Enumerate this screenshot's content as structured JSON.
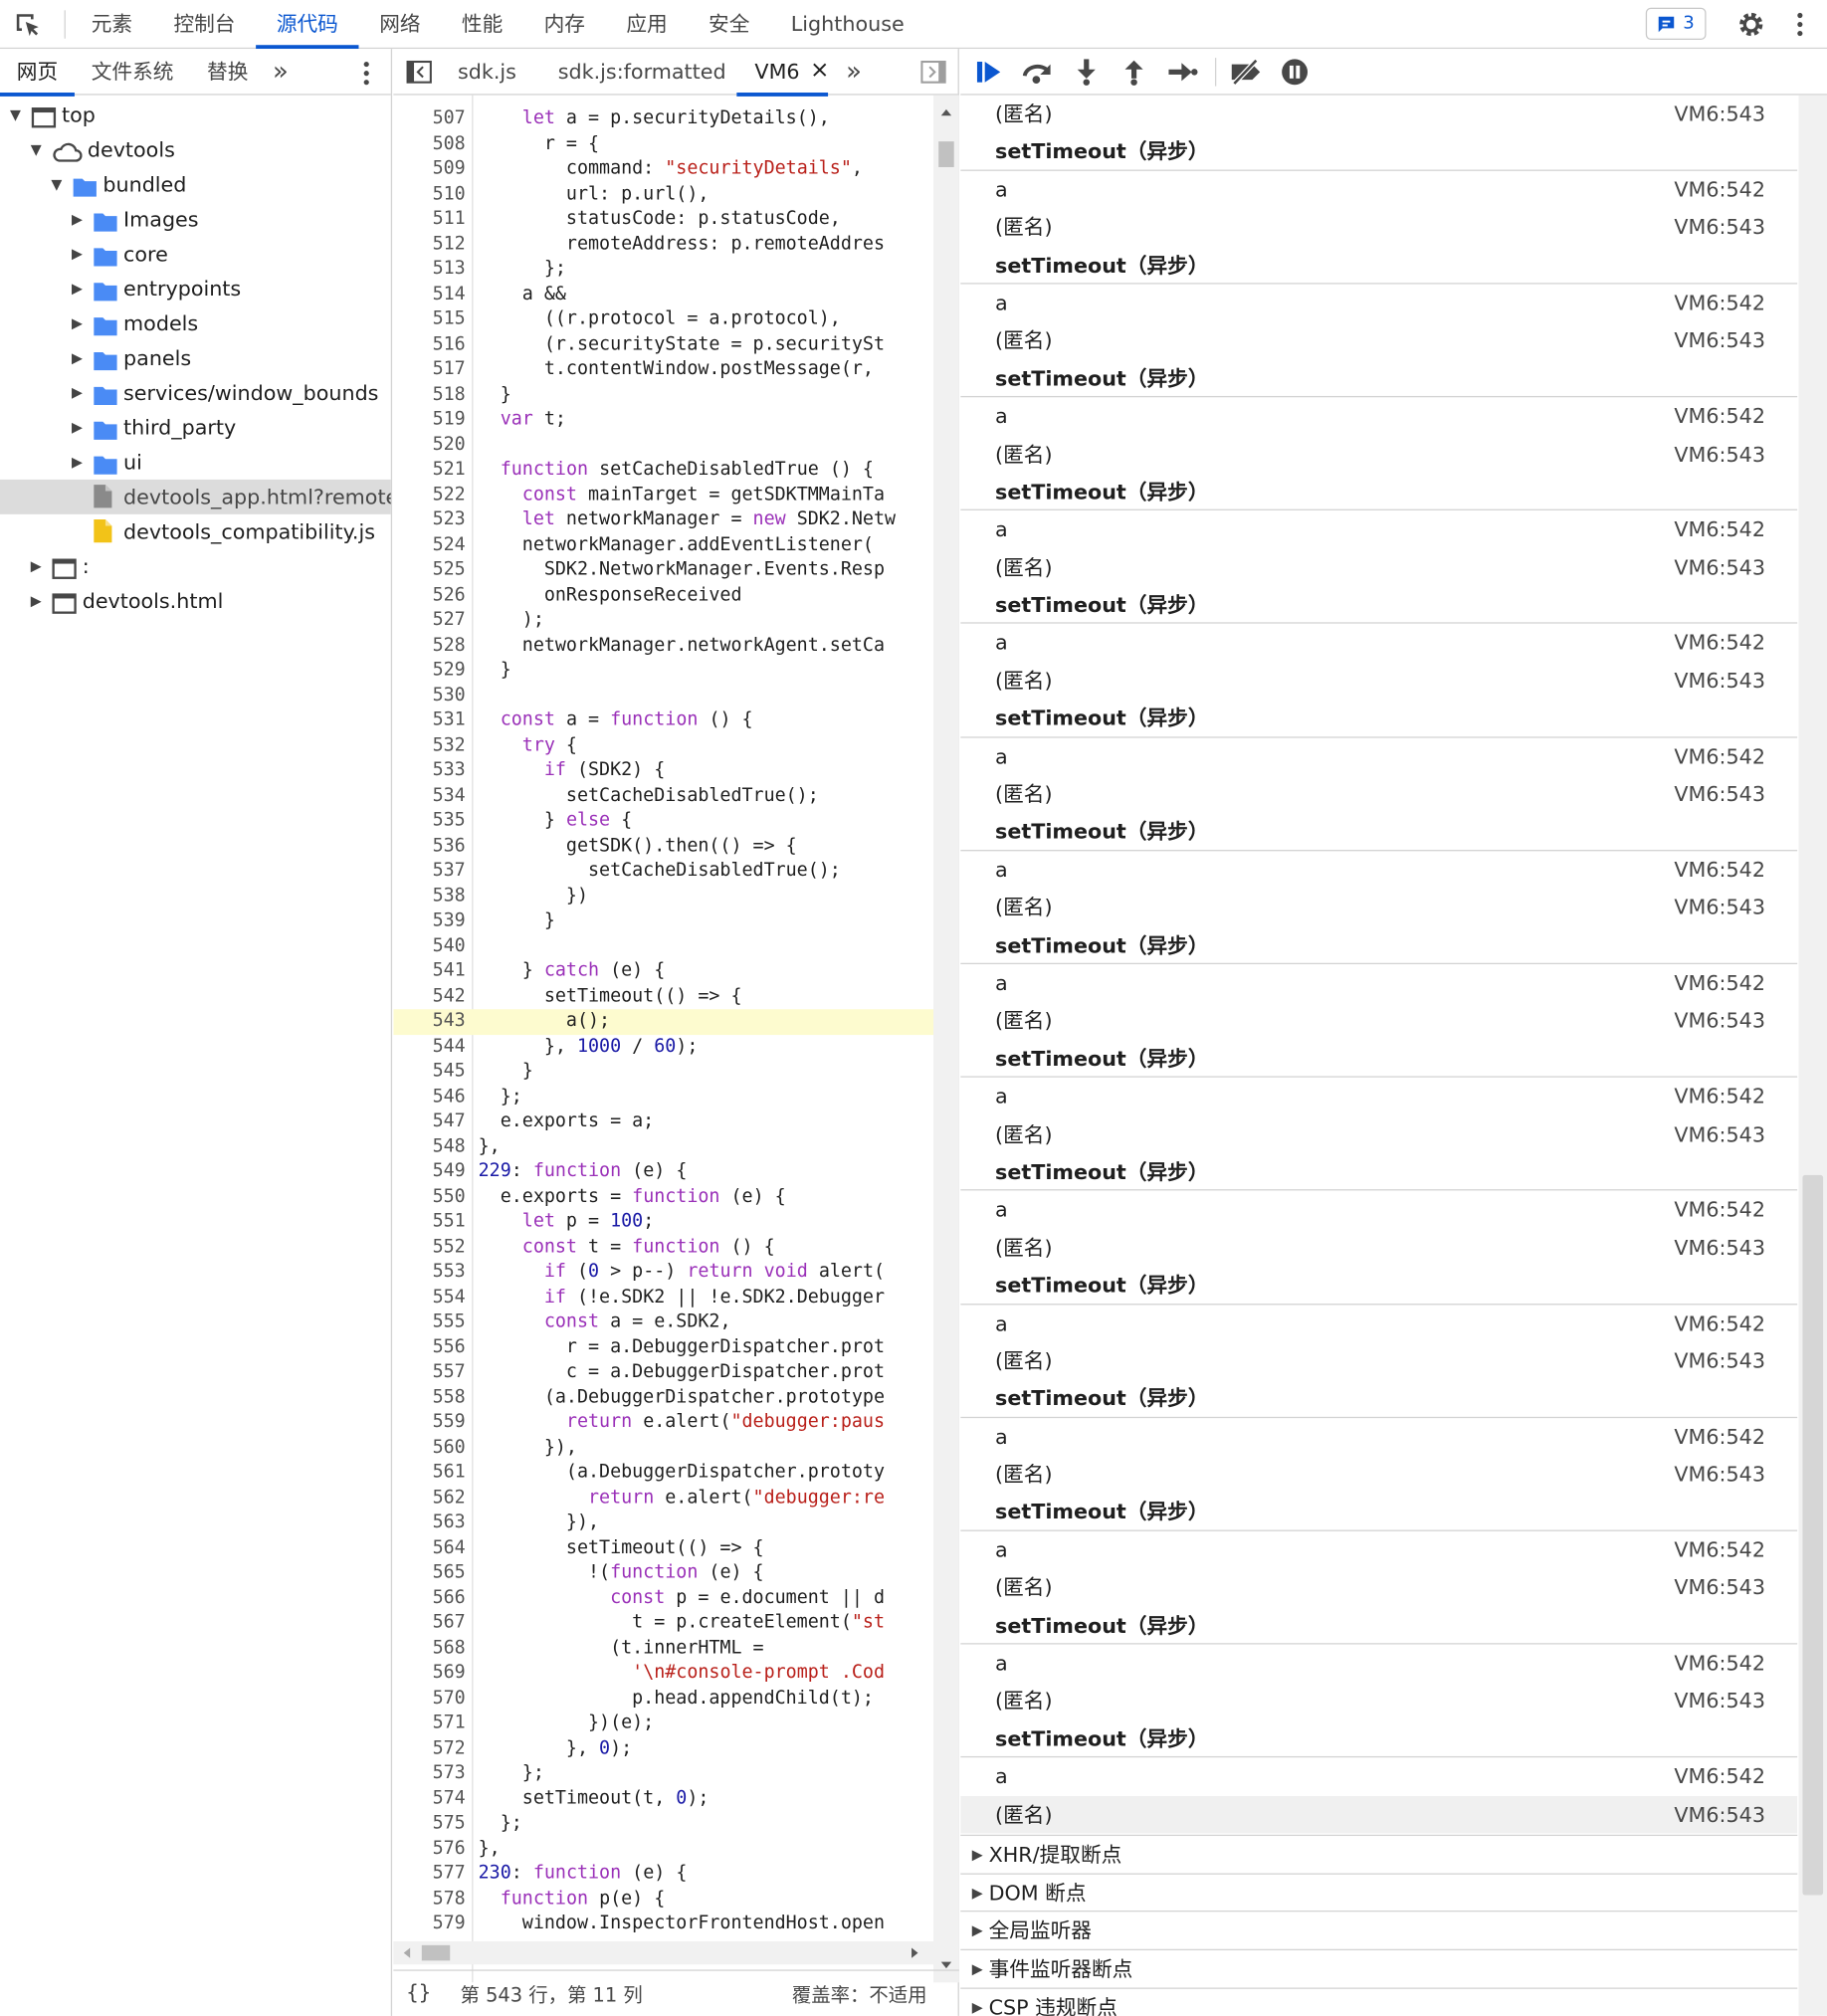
{
  "topbar": {
    "tabs": [
      "元素",
      "控制台",
      "源代码",
      "网络",
      "性能",
      "内存",
      "应用",
      "安全",
      "Lighthouse"
    ],
    "active_tab": 2,
    "issues_count": "3"
  },
  "navigator": {
    "tabs": [
      "网页",
      "文件系统",
      "替换"
    ],
    "more": "»",
    "tree": [
      {
        "label": "top",
        "icon": "frame-icon",
        "depth": 0,
        "tri": "open"
      },
      {
        "label": "devtools",
        "icon": "cloud-icon",
        "depth": 1,
        "tri": "open"
      },
      {
        "label": "bundled",
        "icon": "folder-icon",
        "depth": 2,
        "tri": "open"
      },
      {
        "label": "Images",
        "icon": "folder-icon",
        "depth": 3,
        "tri": "closed"
      },
      {
        "label": "core",
        "icon": "folder-icon",
        "depth": 3,
        "tri": "closed"
      },
      {
        "label": "entrypoints",
        "icon": "folder-icon",
        "depth": 3,
        "tri": "closed"
      },
      {
        "label": "models",
        "icon": "folder-icon",
        "depth": 3,
        "tri": "closed"
      },
      {
        "label": "panels",
        "icon": "folder-icon",
        "depth": 3,
        "tri": "closed"
      },
      {
        "label": "services/window_bounds",
        "icon": "folder-icon",
        "depth": 3,
        "tri": "closed"
      },
      {
        "label": "third_party",
        "icon": "folder-icon",
        "depth": 3,
        "tri": "closed"
      },
      {
        "label": "ui",
        "icon": "folder-icon",
        "depth": 3,
        "tri": "closed"
      },
      {
        "label": "devtools_app.html?remoteBa",
        "icon": "html-file-icon",
        "depth": 3,
        "tri": "none",
        "selected": true
      },
      {
        "label": "devtools_compatibility.js",
        "icon": "js-file-icon",
        "depth": 3,
        "tri": "none"
      },
      {
        "label": ":",
        "icon": "frame-icon",
        "depth": 1,
        "tri": "closed"
      },
      {
        "label": "devtools.html",
        "icon": "frame-icon",
        "depth": 1,
        "tri": "closed"
      }
    ]
  },
  "editor": {
    "tabs": [
      "sdk.js",
      "sdk.js:formatted",
      "VM6"
    ],
    "active_tab": "VM6",
    "close": "×",
    "more": "»",
    "highlight_line": 543,
    "lines": [
      [
        507,
        "    let a = p.securityDetails(),"
      ],
      [
        508,
        "      r = {"
      ],
      [
        509,
        "        command: \"securityDetails\","
      ],
      [
        510,
        "        url: p.url(),"
      ],
      [
        511,
        "        statusCode: p.statusCode,"
      ],
      [
        512,
        "        remoteAddress: p.remoteAddres"
      ],
      [
        513,
        "      };"
      ],
      [
        514,
        "    a &&"
      ],
      [
        515,
        "      ((r.protocol = a.protocol),"
      ],
      [
        516,
        "      (r.securityState = p.securitySt"
      ],
      [
        517,
        "      t.contentWindow.postMessage(r,"
      ],
      [
        518,
        "  }"
      ],
      [
        519,
        "  var t;"
      ],
      [
        520,
        ""
      ],
      [
        521,
        "  function setCacheDisabledTrue () {"
      ],
      [
        522,
        "    const mainTarget = getSDKTMMainTa"
      ],
      [
        523,
        "    let networkManager = new SDK2.Netw"
      ],
      [
        524,
        "    networkManager.addEventListener("
      ],
      [
        525,
        "      SDK2.NetworkManager.Events.Resp"
      ],
      [
        526,
        "      onResponseReceived"
      ],
      [
        527,
        "    );"
      ],
      [
        528,
        "    networkManager.networkAgent.setCa"
      ],
      [
        529,
        "  }"
      ],
      [
        530,
        ""
      ],
      [
        531,
        "  const a = function () {"
      ],
      [
        532,
        "    try {"
      ],
      [
        533,
        "      if (SDK2) {"
      ],
      [
        534,
        "        setCacheDisabledTrue();"
      ],
      [
        535,
        "      } else {"
      ],
      [
        536,
        "        getSDK().then(() => {"
      ],
      [
        537,
        "          setCacheDisabledTrue();"
      ],
      [
        538,
        "        })"
      ],
      [
        539,
        "      }"
      ],
      [
        540,
        ""
      ],
      [
        541,
        "    } catch (e) {"
      ],
      [
        542,
        "      setTimeout(() => {"
      ],
      [
        543,
        "        a();"
      ],
      [
        544,
        "      }, 1000 / 60);"
      ],
      [
        545,
        "    }"
      ],
      [
        546,
        "  };"
      ],
      [
        547,
        "  e.exports = a;"
      ],
      [
        548,
        "},"
      ],
      [
        549,
        "229: function (e) {"
      ],
      [
        550,
        "  e.exports = function (e) {"
      ],
      [
        551,
        "    let p = 100;"
      ],
      [
        552,
        "    const t = function () {"
      ],
      [
        553,
        "      if (0 > p--) return void alert("
      ],
      [
        554,
        "      if (!e.SDK2 || !e.SDK2.Debugger"
      ],
      [
        555,
        "      const a = e.SDK2,"
      ],
      [
        556,
        "        r = a.DebuggerDispatcher.prot"
      ],
      [
        557,
        "        c = a.DebuggerDispatcher.prot"
      ],
      [
        558,
        "      (a.DebuggerDispatcher.prototype"
      ],
      [
        559,
        "        return e.alert(\"debugger:paus"
      ],
      [
        560,
        "      }),"
      ],
      [
        561,
        "        (a.DebuggerDispatcher.prototy"
      ],
      [
        562,
        "          return e.alert(\"debugger:re"
      ],
      [
        563,
        "        }),"
      ],
      [
        564,
        "        setTimeout(() => {"
      ],
      [
        565,
        "          !(function (e) {"
      ],
      [
        566,
        "            const p = e.document || d"
      ],
      [
        567,
        "              t = p.createElement(\"st"
      ],
      [
        568,
        "            (t.innerHTML ="
      ],
      [
        569,
        "              '\\n#console-prompt .Cod"
      ],
      [
        570,
        "              p.head.appendChild(t);"
      ],
      [
        571,
        "          })(e);"
      ],
      [
        572,
        "        }, 0);"
      ],
      [
        573,
        "    };"
      ],
      [
        574,
        "    setTimeout(t, 0);"
      ],
      [
        575,
        "  };"
      ],
      [
        576,
        "},"
      ],
      [
        577,
        "230: function (e) {"
      ],
      [
        578,
        "  function p(e) {"
      ],
      [
        579,
        "    window.InspectorFrontendHost.open"
      ]
    ],
    "status_position": "第 543 行，第 11 列",
    "status_coverage": "覆盖率：不适用",
    "braces": "{}"
  },
  "callstack": {
    "anon_label": "(匿名)",
    "async_label": "setTimeout（异步）",
    "a_label": "a",
    "loc_543": "VM6:543",
    "loc_542": "VM6:542",
    "groups": 15
  },
  "sections": [
    "XHR/提取断点",
    "DOM 断点",
    "全局监听器",
    "事件监听器断点",
    "CSP 违规断点"
  ],
  "colors": {
    "accent": "#0b57d0",
    "keyword": "#9a30b8",
    "string": "#b9201a",
    "number": "#1a1aa6",
    "highlight": "#fdfbcf"
  }
}
